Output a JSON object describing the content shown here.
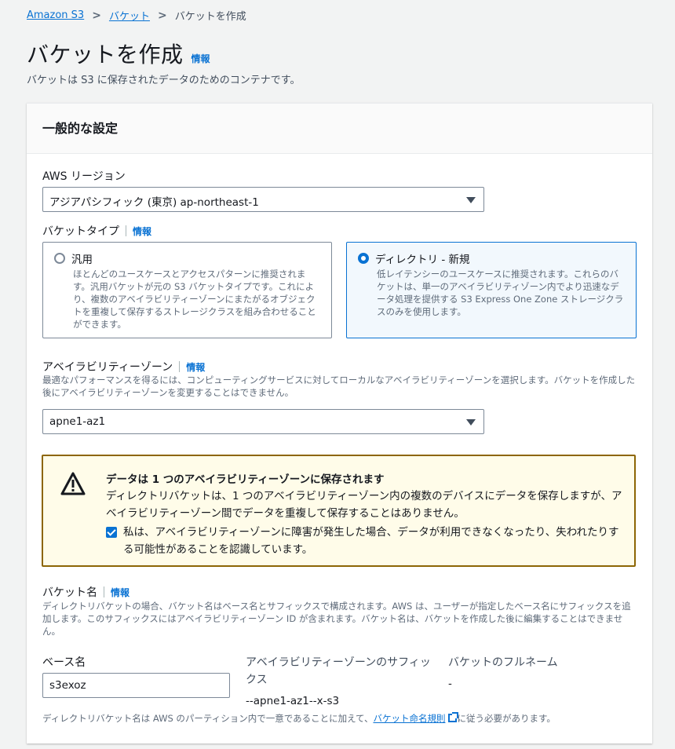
{
  "breadcrumb": {
    "root": "Amazon S3",
    "buckets": "バケット",
    "current": "バケットを作成"
  },
  "header": {
    "title": "バケットを作成",
    "info": "情報",
    "description": "バケットは S3 に保存されたデータのためのコンテナです。"
  },
  "panel": {
    "title": "一般的な設定",
    "region": {
      "label": "AWS リージョン",
      "value": "アジアパシフィック (東京) ap-northeast-1"
    },
    "bucket_type": {
      "label": "バケットタイプ",
      "info": "情報",
      "options": [
        {
          "title": "汎用",
          "description": "ほとんどのユースケースとアクセスパターンに推奨されます。汎用バケットが元の S3 バケットタイプです。これにより、複数のアベイラビリティーゾーンにまたがるオブジェクトを重複して保存するストレージクラスを組み合わせることができます。",
          "selected": false
        },
        {
          "title": "ディレクトリ - 新規",
          "description": "低レイテンシーのユースケースに推奨されます。これらのバケットは、単一のアベイラビリティゾーン内でより迅速なデータ処理を提供する S3 Express One Zone ストレージクラスのみを使用します。",
          "selected": true
        }
      ]
    },
    "az": {
      "label": "アベイラビリティーゾーン",
      "info": "情報",
      "description": "最適なパフォーマンスを得るには、コンピューティングサービスに対してローカルなアベイラビリティーゾーンを選択します。バケットを作成した後にアベイラビリティーゾーンを変更することはできません。",
      "value": "apne1-az1"
    },
    "alert": {
      "title": "データは 1 つのアベイラビリティーゾーンに保存されます",
      "body": "ディレクトリバケットは、1 つのアベイラビリティーゾーン内の複数のデバイスにデータを保存しますが、アベイラビリティーゾーン間でデータを重複して保存することはありません。",
      "ack": "私は、アベイラビリティーゾーンに障害が発生した場合、データが利用できなくなったり、失われたりする可能性があることを認識しています。",
      "ack_checked": true
    },
    "bucket_name": {
      "label": "バケット名",
      "info": "情報",
      "description": "ディレクトリバケットの場合、バケット名はベース名とサフィックスで構成されます。AWS は、ユーザーが指定したベース名にサフィックスを追加します。このサフィックスにはアベイラビリティーゾーン ID が含まれます。バケット名は、バケットを作成した後に編集することはできません。",
      "base_label": "ベース名",
      "base_value": "s3exoz",
      "suffix_label": "アベイラビリティーゾーンのサフィックス",
      "suffix_value": "--apne1-az1--x-s3",
      "full_label": "バケットのフルネーム",
      "full_value": "-",
      "footer_prefix": "ディレクトリバケット名は AWS のパーティション内で一意であることに加えて、",
      "footer_link": "バケット命名規則",
      "footer_suffix": "に従う必要があります。"
    }
  }
}
